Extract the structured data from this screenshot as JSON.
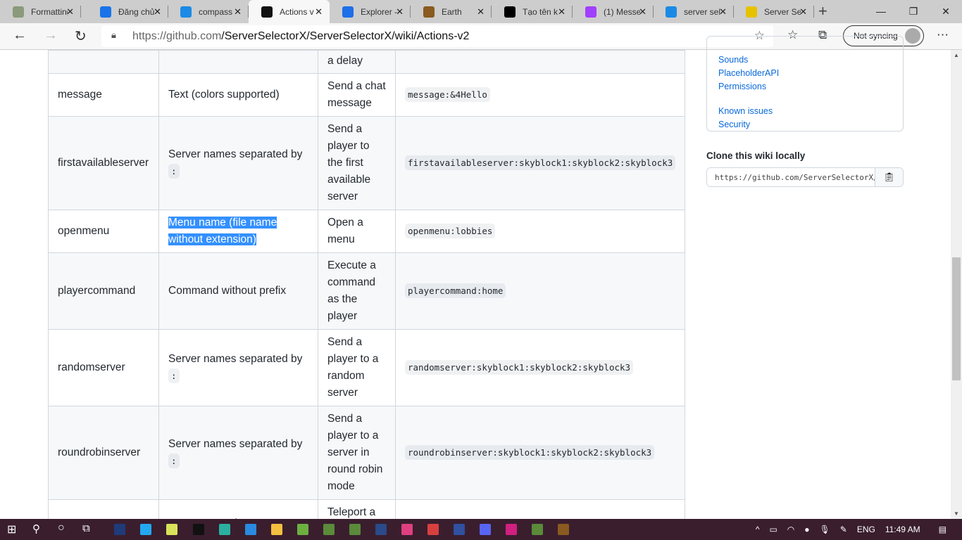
{
  "browser": {
    "tabs": [
      {
        "label": "Formatting",
        "icon": "minecraft-block-icon",
        "color": "#8a9a7a"
      },
      {
        "label": "Đăng chủ",
        "icon": "blue-logo-icon",
        "color": "#1a73e8"
      },
      {
        "label": "compass",
        "icon": "bing-icon",
        "color": "#1b8ae6"
      },
      {
        "label": "Actions v",
        "icon": "github-icon",
        "color": "#111111",
        "active": true
      },
      {
        "label": "Explorer -",
        "icon": "k-logo-icon",
        "color": "#1e6fe8"
      },
      {
        "label": "Earth",
        "icon": "chest-icon",
        "color": "#8a5a20"
      },
      {
        "label": "Tạo tên k",
        "icon": "t-logo-icon",
        "color": "#000000"
      },
      {
        "label": "(1) Messe",
        "icon": "messenger-icon",
        "color": "#a040ff"
      },
      {
        "label": "server sel",
        "icon": "bing-icon",
        "color": "#1b8ae6"
      },
      {
        "label": "Server Se",
        "icon": "server-selector-icon",
        "color": "#e6c200"
      }
    ],
    "url_host": "https://github.com",
    "url_path": "/ServerSelectorX/ServerSelectorX/wiki/Actions-v2",
    "sync_label": "Not syncing"
  },
  "table": {
    "rows": [
      {
        "name": "",
        "param": "",
        "param_code": "",
        "desc": "a delay",
        "example": ""
      },
      {
        "name": "message",
        "param": "Text (colors supported)",
        "desc": "Send a chat message",
        "example": "message:&4Hello"
      },
      {
        "name": "firstavailableserver",
        "param": "Server names separated by",
        "param_code": ":",
        "desc": "Send a player to the first available server",
        "example": "firstavailableserver:skyblock1:skyblock2:skyblock3"
      },
      {
        "name": "openmenu",
        "param": "Menu name (file name without extension)",
        "desc": "Open a menu",
        "example": "openmenu:lobbies"
      },
      {
        "name": "playercommand",
        "param": "Command without prefix",
        "desc": "Execute a command as the player",
        "example": "playercommand:home"
      },
      {
        "name": "randomserver",
        "param": "Server names separated by",
        "param_code": ":",
        "desc": "Send a player to a random server",
        "example": "randomserver:skyblock1:skyblock2:skyblock3"
      },
      {
        "name": "roundrobinserver",
        "param": "Server names separated by",
        "param_code": ":",
        "desc": "Send a player to a server in round robin mode",
        "example": "roundrobinserver:skyblock1:skyblock2:skyblock3"
      },
      {
        "name": "",
        "param": "Server name for",
        "desc": "Teleport a",
        "example": ""
      }
    ]
  },
  "sidebar": {
    "links": [
      "Sounds",
      "PlaceholderAPI",
      "Permissions",
      "Known issues",
      "Security"
    ],
    "clone_title": "Clone this wiki locally",
    "clone_url": "https://github.com/ServerSelectorX/ServerSelectorX.wiki.git"
  },
  "taskbar": {
    "lang": "ENG",
    "time": "11:49 AM"
  }
}
